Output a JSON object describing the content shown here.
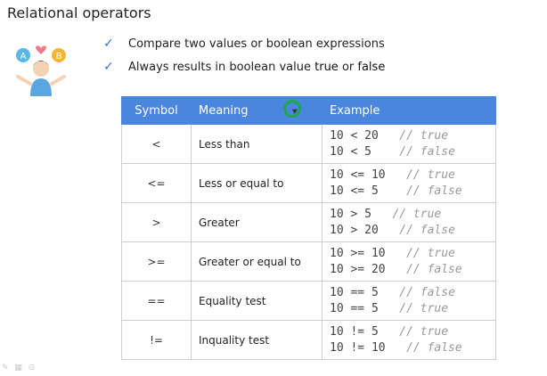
{
  "slide": {
    "title": "Relational operators"
  },
  "bullets": [
    {
      "icon": "checkmark-icon",
      "text": "Compare two values or boolean expressions"
    },
    {
      "icon": "checkmark-icon",
      "text_before": "Always results in boolean value ",
      "true_word": "true",
      "or_word": " or ",
      "false_word": "false"
    }
  ],
  "table": {
    "headers": [
      "Symbol",
      "Meaning",
      "Example"
    ],
    "rows": [
      {
        "symbol": "<",
        "meaning": "Less than",
        "examples": [
          {
            "code": "10 < 20   ",
            "comment": "// true"
          },
          {
            "code": "10 < 5    ",
            "comment": "// false"
          }
        ]
      },
      {
        "symbol": "<=",
        "meaning": "Less or equal to",
        "examples": [
          {
            "code": "10 <= 10   ",
            "comment": "// true"
          },
          {
            "code": "10 <= 5    ",
            "comment": "// false"
          }
        ]
      },
      {
        "symbol": ">",
        "meaning": "Greater",
        "examples": [
          {
            "code": "10 > 5   ",
            "comment": "// true"
          },
          {
            "code": "10 > 20   ",
            "comment": "// false"
          }
        ]
      },
      {
        "symbol": ">=",
        "meaning": "Greater or equal to",
        "examples": [
          {
            "code": "10 >= 10   ",
            "comment": "// true"
          },
          {
            "code": "10 >= 20   ",
            "comment": "// false"
          }
        ]
      },
      {
        "symbol": "==",
        "meaning": "Equality test",
        "examples": [
          {
            "code": "10 == 5   ",
            "comment": "// false"
          },
          {
            "code": "10 == 5   ",
            "comment": "// true"
          }
        ]
      },
      {
        "symbol": "!=",
        "meaning": "Inquality test",
        "examples": [
          {
            "code": "10 != 5   ",
            "comment": "// true"
          },
          {
            "code": "10 != 10   ",
            "comment": "// false"
          }
        ]
      }
    ]
  },
  "colors": {
    "header_bg": "#4a86dd",
    "check": "#3b6fd8",
    "comment": "#9a9a9a",
    "cursor_ring": "#1fa64a"
  }
}
